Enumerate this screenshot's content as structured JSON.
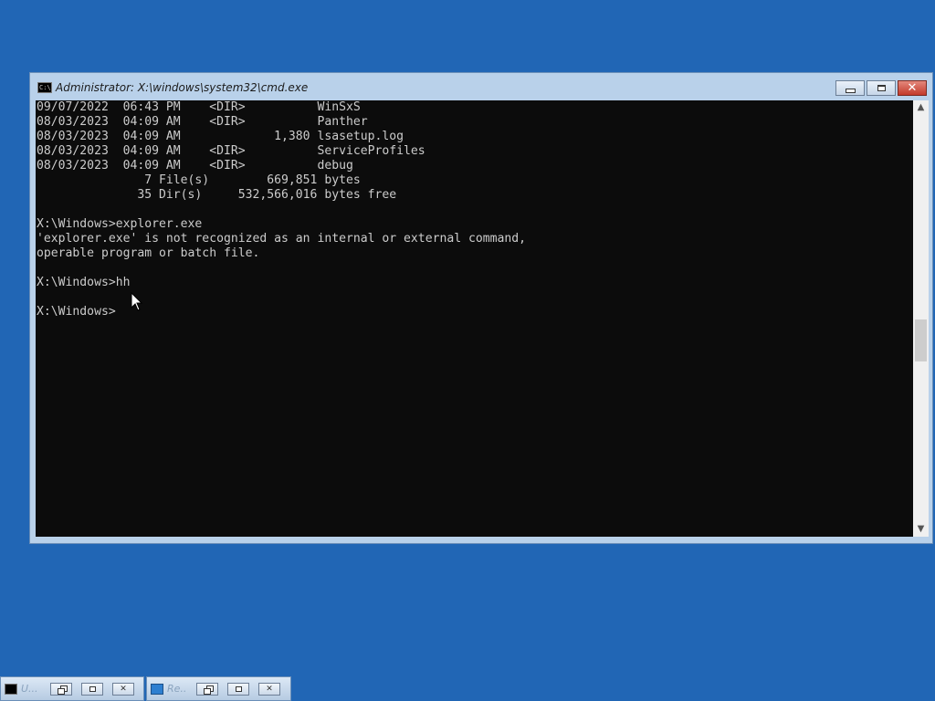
{
  "window": {
    "title": "Administrator: X:\\windows\\system32\\cmd.exe",
    "icon": "cmd-icon",
    "icon_text": "C:\\"
  },
  "console": {
    "lines": [
      "09/07/2022  06:43 PM    <DIR>          WinSxS",
      "08/03/2023  04:09 AM    <DIR>          Panther",
      "08/03/2023  04:09 AM             1,380 lsasetup.log",
      "08/03/2023  04:09 AM    <DIR>          ServiceProfiles",
      "08/03/2023  04:09 AM    <DIR>          debug",
      "               7 File(s)        669,851 bytes",
      "              35 Dir(s)     532,566,016 bytes free",
      "",
      "X:\\Windows>explorer.exe",
      "'explorer.exe' is not recognized as an internal or external command,",
      "operable program or batch file.",
      "",
      "X:\\Windows>hh",
      "",
      "X:\\Windows>"
    ]
  },
  "taskbar": {
    "items": [
      {
        "label": "U...",
        "icon": "cmd-icon"
      },
      {
        "label": "Re...",
        "icon": "regedit-icon"
      }
    ],
    "close_glyph": "✕"
  },
  "caption": {
    "close_glyph": "✕"
  },
  "scroll": {
    "up": "▲",
    "down": "▼"
  },
  "colors": {
    "desktop": "#2166b5",
    "console_bg": "#0c0c0c",
    "console_fg": "#cccccc",
    "close_button": "#c33a2b"
  }
}
